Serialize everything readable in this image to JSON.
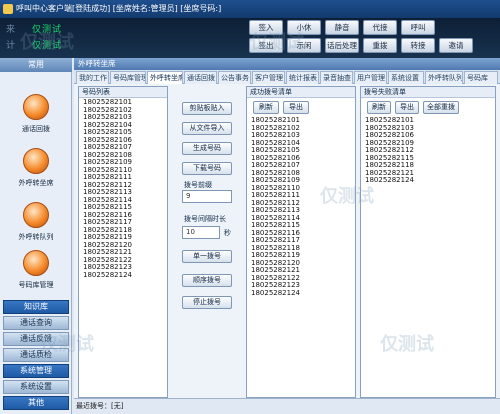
{
  "window": {
    "title": "呼叫中心客户端[登陆成功] [坐席姓名:管理员] [坐席号码:]"
  },
  "led": {
    "row1_label": "来",
    "row1_value": "仅测试",
    "row2_label": "计",
    "row2_value": "仅测试"
  },
  "toolbar": {
    "row1": [
      "签入",
      "小休",
      "静音",
      "代接",
      "呼叫",
      "",
      ""
    ],
    "row2": [
      "签出",
      "示闲",
      "话后处理",
      "重拨",
      "转接",
      "邀请"
    ]
  },
  "sidebar": {
    "header": "常用",
    "items": [
      {
        "label": "通话回拨"
      },
      {
        "label": "外呼转坐席"
      },
      {
        "label": "外呼转队列"
      },
      {
        "label": "号码库管理"
      }
    ],
    "buttons": [
      "知识库",
      "通话查询",
      "通话反馈",
      "通话质检",
      "系统管理",
      "系统设置",
      "其他"
    ]
  },
  "main": {
    "title": "外呼转坐席",
    "tabs": [
      "我的工作台",
      "号码库管理",
      "外呼转坐席",
      "通话回拨",
      "公告事务",
      "客户管理",
      "统计报表",
      "录音抽查",
      "用户管理",
      "系统设置",
      "外呼转队列",
      "号码库"
    ]
  },
  "numbers_panel": {
    "title": "号码列表",
    "items": [
      "18025282101",
      "18025282102",
      "18025282103",
      "18025282104",
      "18025282105",
      "18025282106",
      "18025282107",
      "18025282108",
      "18025282109",
      "18025282110",
      "18025282111",
      "18025282112",
      "18025282113",
      "18025282114",
      "18025282115",
      "18025282116",
      "18025282117",
      "18025282118",
      "18025282119",
      "18025282120",
      "18025282121",
      "18025282122",
      "18025282123",
      "18025282124"
    ]
  },
  "controls": {
    "paste_button": "剪贴板贴入",
    "import_button": "从文件导入",
    "generate_button": "生成号码",
    "download_button": "下载号码",
    "prefix_label": "拨号前缀",
    "prefix_value": "9",
    "interval_label": "拨号间隔时长",
    "interval_value": "10",
    "interval_unit": "秒",
    "single_button": "单一拨号",
    "sequence_button": "顺序拨号",
    "stop_button": "停止拨号"
  },
  "success_panel": {
    "title": "成功拨号清单",
    "refresh": "刷新",
    "export": "导出",
    "items": [
      "18025282101",
      "18025282102",
      "18025282103",
      "18025282104",
      "18025282105",
      "18025282106",
      "18025282107",
      "18025282108",
      "18025282109",
      "18025282110",
      "18025282111",
      "18025282112",
      "18025282113",
      "18025282114",
      "18025282115",
      "18025282116",
      "18025282117",
      "18025282118",
      "18025282119",
      "18025282120",
      "18025282121",
      "18025282122",
      "18025282123",
      "18025282124"
    ]
  },
  "failed_panel": {
    "title": "拨号失败清单",
    "refresh": "刷新",
    "export": "导出",
    "redial": "全部重拨",
    "items": [
      "18025282101",
      "18025282103",
      "18025282106",
      "18025282109",
      "18025282112",
      "18025282115",
      "18025282118",
      "18025282121",
      "18025282124"
    ]
  },
  "status": {
    "text": "最近拨号：[无]"
  },
  "watermark": "仅测试"
}
